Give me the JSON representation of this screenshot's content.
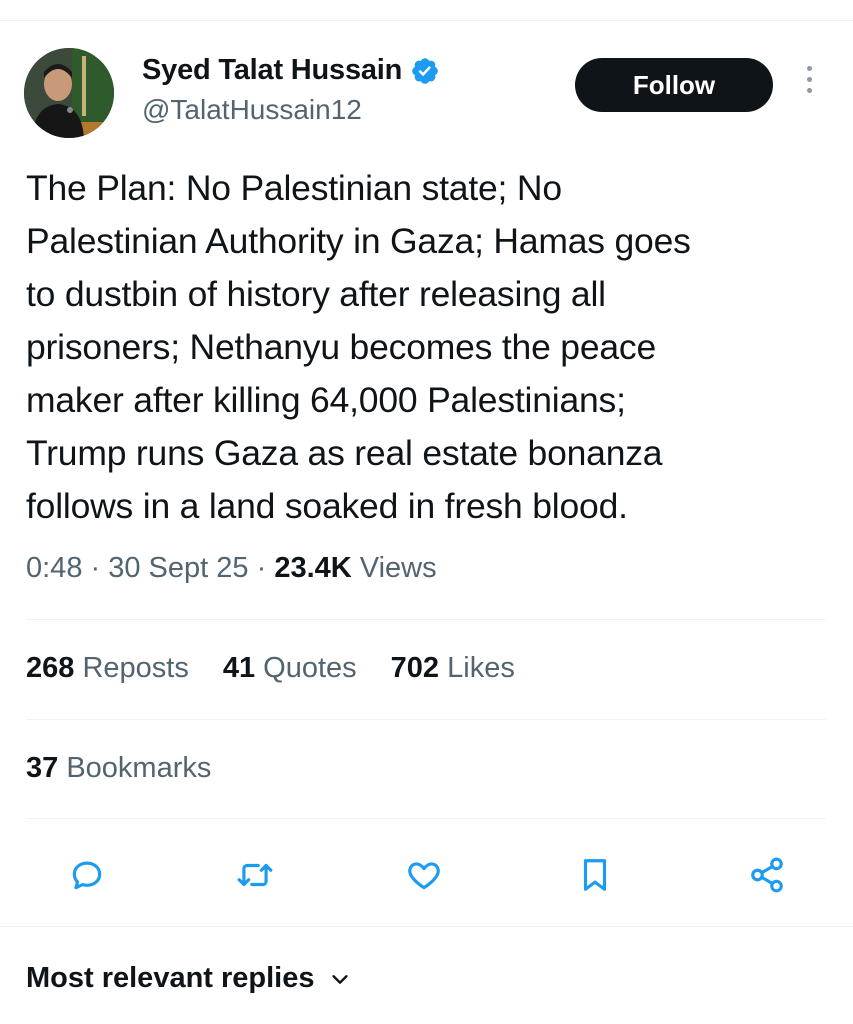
{
  "author": {
    "display_name": "Syed Talat Hussain",
    "handle": "@TalatHussain12",
    "verified": true
  },
  "header": {
    "follow_label": "Follow"
  },
  "tweet": {
    "lines": [
      "The Plan: No Palestinian state; No",
      "Palestinian Authority in Gaza; Hamas goes",
      "to dustbin of history after releasing all",
      "prisoners; Nethanyu becomes the peace",
      "maker after killing 64,000 Palestinians;",
      "Trump runs Gaza as real estate bonanza",
      "follows in a land soaked in fresh blood."
    ],
    "time": "0:48",
    "date": "30 Sept 25",
    "views_count": "23.4K",
    "views_label": "Views"
  },
  "stats": {
    "reposts_count": "268",
    "reposts_label": "Reposts",
    "quotes_count": "41",
    "quotes_label": "Quotes",
    "likes_count": "702",
    "likes_label": "Likes",
    "bookmarks_count": "37",
    "bookmarks_label": "Bookmarks"
  },
  "actions": [
    "reply-icon",
    "repost-icon",
    "like-icon",
    "bookmark-icon",
    "share-icon"
  ],
  "replies": {
    "sort_label": "Most relevant replies"
  },
  "colors": {
    "text_primary": "#0f1419",
    "text_secondary": "#536471",
    "accent": "#1d9bf0",
    "divider": "#eff3f4",
    "button_bg": "#0f1419"
  }
}
